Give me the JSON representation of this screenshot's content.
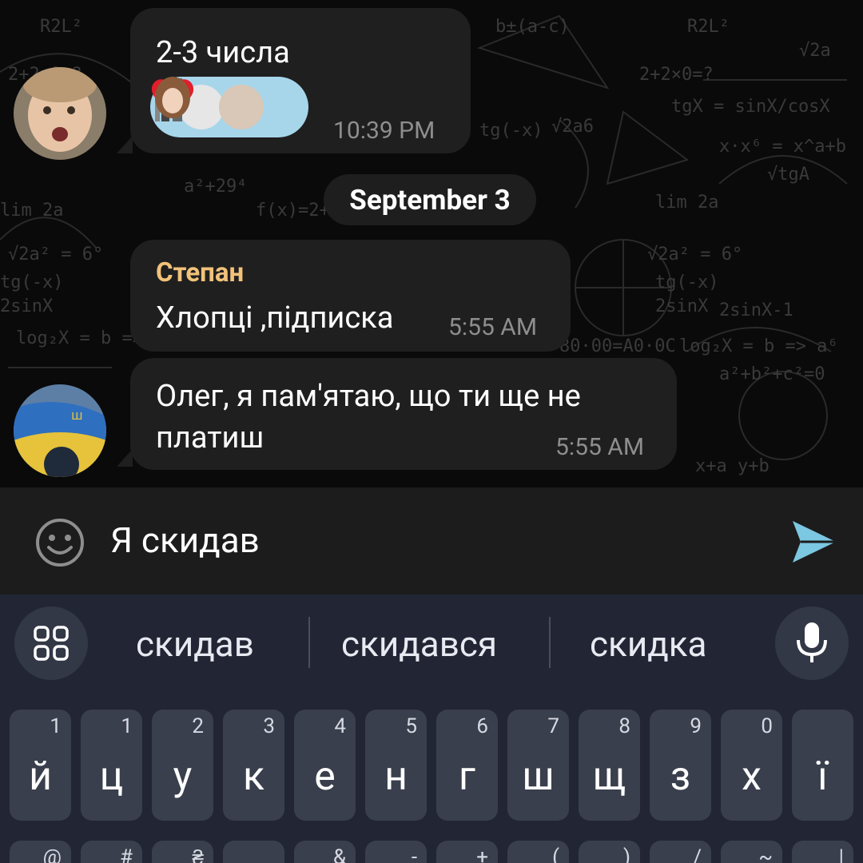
{
  "chat": {
    "msg1": {
      "text": "2-3 числа",
      "time": "10:39 PM"
    },
    "date_separator": "September 3",
    "msg2": {
      "sender": "Степан",
      "text": "Хлопці ,підписка",
      "time": "5:55 AM"
    },
    "msg3": {
      "text_line1": "Олег, я пам'ятаю, що ти ще не",
      "text_line2": "платиш",
      "time": "5:55 AM"
    }
  },
  "input": {
    "value": "Я скидав",
    "emoji_icon": "smiley-icon",
    "send_icon": "send-icon"
  },
  "keyboard": {
    "suggestions": [
      "скидав",
      "скидався",
      "скидка"
    ],
    "row1": [
      {
        "ch": "й",
        "num": "1"
      },
      {
        "ch": "ц",
        "num": "1"
      },
      {
        "ch": "у",
        "num": "2"
      },
      {
        "ch": "к",
        "num": "3"
      },
      {
        "ch": "е",
        "num": "4"
      },
      {
        "ch": "н",
        "num": "5"
      },
      {
        "ch": "г",
        "num": "6"
      },
      {
        "ch": "ш",
        "num": "7"
      },
      {
        "ch": "щ",
        "num": "8"
      },
      {
        "ch": "з",
        "num": "9"
      },
      {
        "ch": "х",
        "num": "0"
      },
      {
        "ch": "ї",
        "num": ""
      }
    ],
    "row2_hints": [
      "@",
      "#",
      "₴",
      "_",
      "&",
      "-",
      "+",
      "(",
      ")",
      "/",
      "~",
      "|"
    ]
  },
  "colors": {
    "accent_send": "#7cc7e2",
    "sender_name": "#f2c27a",
    "reaction_bg": "#a7d6eb"
  }
}
